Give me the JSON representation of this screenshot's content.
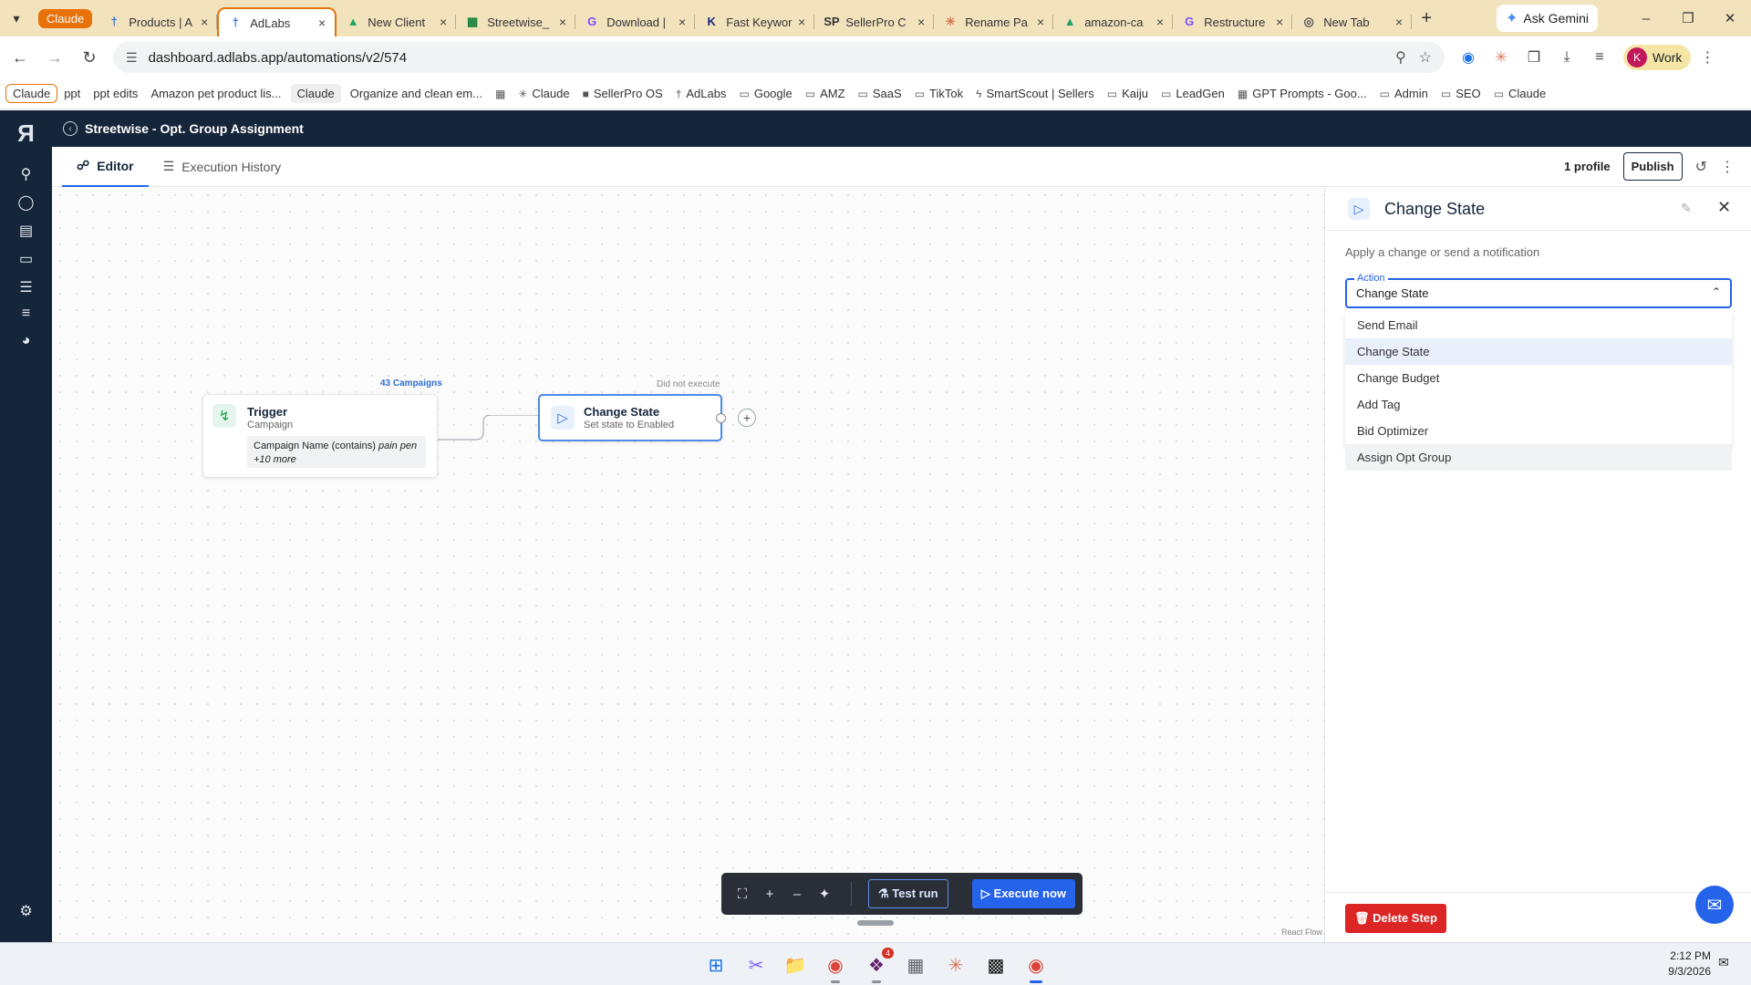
{
  "browser": {
    "tab_group": "Claude",
    "tabs": [
      {
        "label": "Products | A",
        "icon": "adlabs-icon",
        "glyph": "†",
        "color": "#2f6fd3"
      },
      {
        "label": "AdLabs",
        "icon": "adlabs-icon",
        "glyph": "†",
        "color": "#2f6fd3",
        "active": true
      },
      {
        "label": "New Client",
        "icon": "drive-icon",
        "glyph": "▲",
        "color": "#1fa463"
      },
      {
        "label": "Streetwise_",
        "icon": "sheets-icon",
        "glyph": "▦",
        "color": "#188038"
      },
      {
        "label": "Download |",
        "icon": "g-icon",
        "glyph": "G",
        "color": "#7c4dff"
      },
      {
        "label": "Fast Keywor",
        "icon": "k-icon",
        "glyph": "K",
        "color": "#1a237e"
      },
      {
        "label": "SellerPro C",
        "icon": "sellerpro-icon",
        "glyph": "SP",
        "color": "#333"
      },
      {
        "label": "Rename Pa",
        "icon": "claude-icon",
        "glyph": "✳",
        "color": "#d97757"
      },
      {
        "label": "amazon-ca",
        "icon": "drive-icon",
        "glyph": "▲",
        "color": "#1fa463"
      },
      {
        "label": "Restructure",
        "icon": "g-icon",
        "glyph": "G",
        "color": "#7c4dff"
      },
      {
        "label": "New Tab",
        "icon": "chrome-icon",
        "glyph": "◎",
        "color": "#555"
      }
    ],
    "gemini_label": "Ask Gemini",
    "url": "dashboard.adlabs.app/automations/v2/574",
    "profile_initial": "K",
    "profile_label": "Work",
    "bookmarks": [
      {
        "label": "Claude",
        "style": "outlined"
      },
      {
        "label": "ppt"
      },
      {
        "label": "ppt edits"
      },
      {
        "label": "Amazon pet product lis..."
      },
      {
        "label": "Claude",
        "style": "grey"
      },
      {
        "label": "Organize and clean em..."
      },
      {
        "label": "",
        "icon": "apps-grid-icon",
        "glyph": "▦"
      },
      {
        "label": "Claude",
        "icon": "claude-icon",
        "glyph": "✳"
      },
      {
        "label": "SellerPro OS",
        "icon": "sellerpro-icon",
        "glyph": "■"
      },
      {
        "label": "AdLabs",
        "icon": "adlabs-icon",
        "glyph": "†"
      },
      {
        "label": "Google",
        "icon": "folder-icon",
        "glyph": "▭"
      },
      {
        "label": "AMZ",
        "icon": "folder-icon",
        "glyph": "▭"
      },
      {
        "label": "SaaS",
        "icon": "folder-icon",
        "glyph": "▭"
      },
      {
        "label": "TikTok",
        "icon": "folder-icon",
        "glyph": "▭"
      },
      {
        "label": "SmartScout | Sellers",
        "icon": "smartscout-icon",
        "glyph": "ϟ"
      },
      {
        "label": "Kaiju",
        "icon": "folder-icon",
        "glyph": "▭"
      },
      {
        "label": "LeadGen",
        "icon": "folder-icon",
        "glyph": "▭"
      },
      {
        "label": "GPT Prompts - Goo...",
        "icon": "sheets-icon",
        "glyph": "▦"
      },
      {
        "label": "Admin",
        "icon": "folder-icon",
        "glyph": "▭"
      },
      {
        "label": "SEO",
        "icon": "folder-icon",
        "glyph": "▭"
      },
      {
        "label": "Claude",
        "icon": "folder-icon",
        "glyph": "▭"
      }
    ]
  },
  "app": {
    "title": "Streetwise - Opt. Group Assignment",
    "tabs": [
      {
        "label": "Editor",
        "icon": "flow-icon",
        "glyph": "⚔"
      },
      {
        "label": "Execution History",
        "icon": "list-icon",
        "glyph": "☰"
      }
    ],
    "profile_count": "1 profile",
    "publish_label": "Publish",
    "canvas": {
      "trigger": {
        "title": "Trigger",
        "subtitle": "Campaign",
        "condition": "Campaign Name (contains)",
        "condition_value": "pain pen",
        "more": "+10 more",
        "badge": "43 Campaigns"
      },
      "action": {
        "title": "Change State",
        "subtitle": "Set state to Enabled",
        "badge": "Did not execute"
      },
      "test_run": "Test run",
      "execute_now": "Execute now",
      "react_flow": "React Flow"
    },
    "panel": {
      "title": "Change State",
      "description": "Apply a change or send a notification",
      "action_label": "Action",
      "action_value": "Change State",
      "options": [
        "Send Email",
        "Change State",
        "Change Budget",
        "Add Tag",
        "Bid Optimizer",
        "Assign Opt Group"
      ],
      "selected_option": "Change State",
      "hovered_option": "Assign Opt Group",
      "delete_label": "Delete Step"
    }
  },
  "taskbar": {
    "time": "2:12 PM",
    "date": "9/3/2026",
    "slack_badge": "4"
  }
}
